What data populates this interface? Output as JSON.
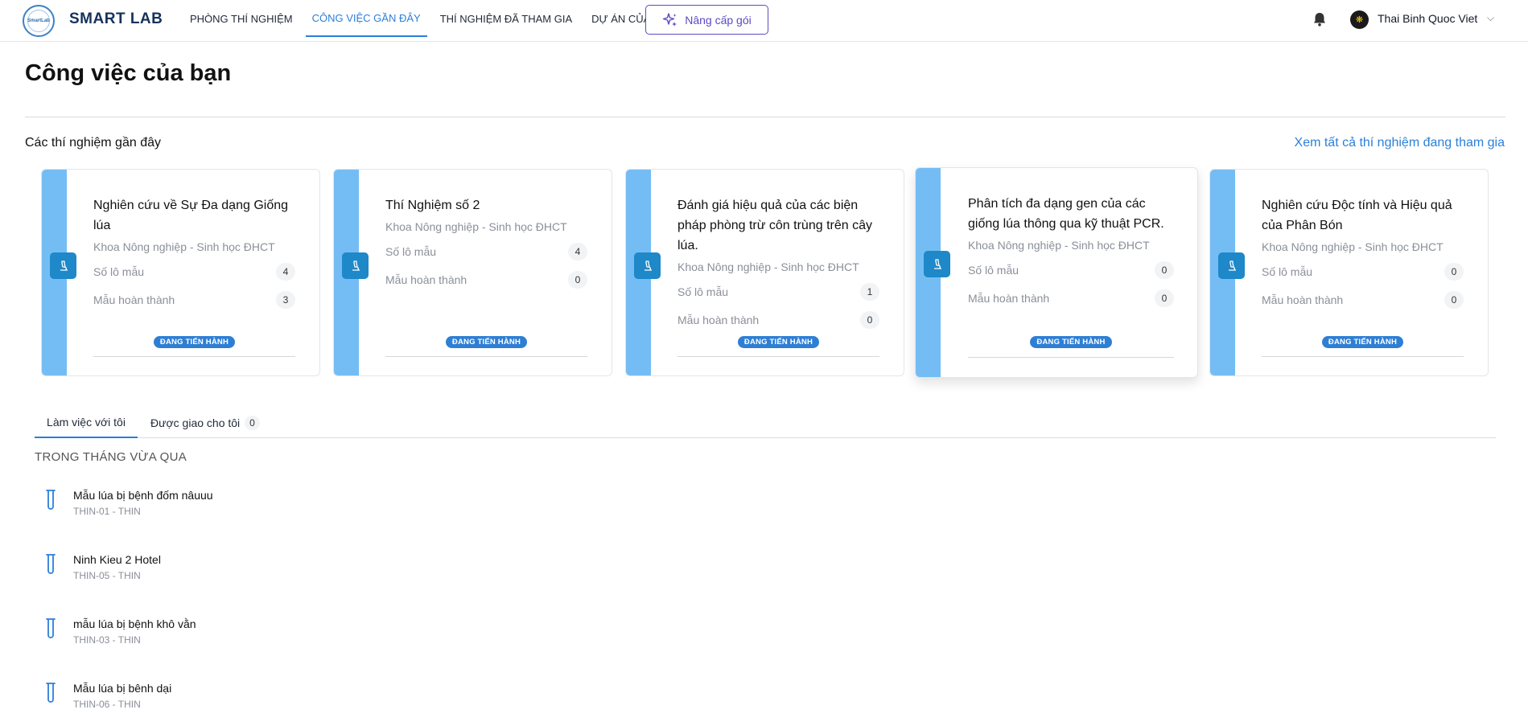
{
  "header": {
    "logo_text": "SmartLab",
    "brand": "SMART LAB",
    "nav": [
      {
        "label": "PHÒNG THÍ NGHIỆM",
        "active": false
      },
      {
        "label": "CÔNG VIỆC GẦN ĐÂY",
        "active": true
      },
      {
        "label": "THÍ NGHIỆM ĐÃ THAM GIA",
        "active": false
      },
      {
        "label": "DỰ ÁN CỦA TÔI",
        "active": false
      }
    ],
    "upgrade_label": "Nâng cấp gói",
    "user_name": "Thai Binh Quoc Viet",
    "accent_color": "#2b7fd9",
    "upgrade_color": "#5b4bc4"
  },
  "page": {
    "title": "Công việc của bạn",
    "recent_section_title": "Các thí nghiệm gần đây",
    "view_all_label": "Xem tất cả thí nghiệm đang tham gia"
  },
  "cards": [
    {
      "title": "Nghiên cứu về Sự Đa dạng Giống lúa",
      "dept": "Khoa Nông nghiệp - Sinh học ĐHCT",
      "samples_label": "Số lô mẫu",
      "samples": "4",
      "done_label": "Mẫu hoàn thành",
      "done": "3",
      "status": "ĐANG TIẾN HÀNH"
    },
    {
      "title": "Thí Nghiệm số 2",
      "dept": "Khoa Nông nghiệp - Sinh học ĐHCT",
      "samples_label": "Số lô mẫu",
      "samples": "4",
      "done_label": "Mẫu hoàn thành",
      "done": "0",
      "status": "ĐANG TIẾN HÀNH"
    },
    {
      "title": "Đánh giá hiệu quả của các biện pháp phòng trừ côn trùng trên cây lúa.",
      "dept": "Khoa Nông nghiệp - Sinh học ĐHCT",
      "samples_label": "Số lô mẫu",
      "samples": "1",
      "done_label": "Mẫu hoàn thành",
      "done": "0",
      "status": "ĐANG TIẾN HÀNH"
    },
    {
      "title": "Phân tích đa dạng gen của các giống lúa thông qua kỹ thuật PCR.",
      "dept": "Khoa Nông nghiệp - Sinh học ĐHCT",
      "samples_label": "Số lô mẫu",
      "samples": "0",
      "done_label": "Mẫu hoàn thành",
      "done": "0",
      "status": "ĐANG TIẾN HÀNH"
    },
    {
      "title": "Nghiên cứu Độc tính và Hiệu quả của Phân Bón",
      "dept": "Khoa Nông nghiệp - Sinh học ĐHCT",
      "samples_label": "Số lô mẫu",
      "samples": "0",
      "done_label": "Mẫu hoàn thành",
      "done": "0",
      "status": "ĐANG TIẾN HÀNH"
    }
  ],
  "tabs": [
    {
      "label": "Làm việc với tôi",
      "active": true
    },
    {
      "label": "Được giao cho tôi",
      "count": "0",
      "active": false
    }
  ],
  "period_label": "TRONG THÁNG VỪA QUA",
  "items": [
    {
      "title": "Mẫu lúa bị bệnh đốm nâuuu",
      "sub": "THIN-01 - THIN"
    },
    {
      "title": "Ninh Kieu 2 Hotel",
      "sub": "THIN-05 - THIN"
    },
    {
      "title": "mẫu lúa bị bệnh khô vằn",
      "sub": "THIN-03 - THIN"
    },
    {
      "title": "Mẫu lúa bị bênh dại",
      "sub": "THIN-06 - THIN"
    }
  ]
}
